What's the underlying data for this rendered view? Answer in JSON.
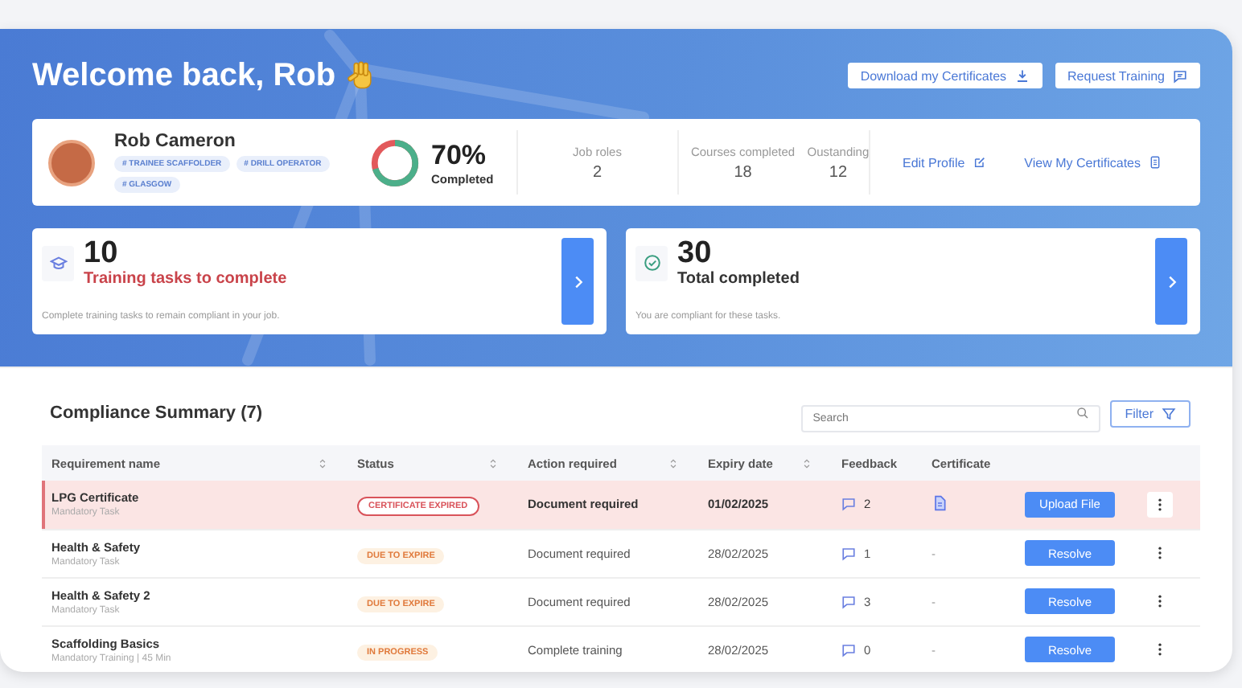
{
  "header": {
    "title": "Welcome back, Rob",
    "buttons": [
      {
        "label": "Download my Certificates"
      },
      {
        "label": "Request Training"
      }
    ]
  },
  "profile": {
    "name": "Rob Cameron",
    "tags": [
      "# TRAINEE SCAFFOLDER",
      "# DRILL OPERATOR",
      "# GLASGOW"
    ],
    "progress": {
      "level": 0.7,
      "value": "70%",
      "label": "Completed"
    },
    "stats": [
      {
        "label": "Job roles",
        "value": "2"
      },
      {
        "label": "Courses completed",
        "value": "18"
      },
      {
        "label": "Oustanding",
        "value": "12"
      }
    ],
    "links": [
      {
        "label": "Edit Profile"
      },
      {
        "label": "View My Certificates"
      }
    ]
  },
  "summary_cards": [
    {
      "kind": "pending",
      "count": "10",
      "title": "Training tasks to complete",
      "description": "Complete training tasks to remain compliant in your job."
    },
    {
      "kind": "completed",
      "count": "30",
      "title": "Total completed",
      "description": "You are compliant for these tasks."
    }
  ],
  "compliance": {
    "title": "Compliance Summary (7)",
    "search": {
      "placeholder": "Search"
    },
    "filter_button": "Filter",
    "columns": [
      {
        "label": "Requirement name",
        "sortable": true
      },
      {
        "label": "Status",
        "sortable": true
      },
      {
        "label": "Action required",
        "sortable": true
      },
      {
        "label": "Expiry date",
        "sortable": true
      },
      {
        "label": "Feedback",
        "sortable": false
      },
      {
        "label": "Certificate",
        "sortable": false
      }
    ],
    "rows": [
      {
        "name": "LPG Certificate",
        "subtitle": "Mandatory Task",
        "highlighted": true,
        "status": {
          "label": "CERTIFICATE EXPIRED",
          "kind": "expired"
        },
        "action": "Document required",
        "expiry": "01/02/2025",
        "feedback": "2",
        "certificate": {
          "kind": "file"
        },
        "button": "Upload File"
      },
      {
        "name": "Health & Safety",
        "subtitle": "Mandatory Task",
        "highlighted": false,
        "status": {
          "label": "DUE TO EXPIRE",
          "kind": "due"
        },
        "action": "Document required",
        "expiry": "28/02/2025",
        "feedback": "1",
        "certificate": {
          "kind": "text",
          "text": "-"
        },
        "button": "Resolve"
      },
      {
        "name": "Health & Safety 2",
        "subtitle": "Mandatory Task",
        "highlighted": false,
        "status": {
          "label": "DUE TO EXPIRE",
          "kind": "due"
        },
        "action": "Document required",
        "expiry": "28/02/2025",
        "feedback": "3",
        "certificate": {
          "kind": "text",
          "text": "-"
        },
        "button": "Resolve"
      },
      {
        "name": "Scaffolding Basics",
        "subtitle": "Mandatory Training | 45 Min",
        "highlighted": false,
        "status": {
          "label": "IN PROGRESS",
          "kind": "progress"
        },
        "action": "Complete training",
        "expiry": "28/02/2025",
        "feedback": "0",
        "certificate": {
          "kind": "text",
          "text": "-"
        },
        "button": "Resolve"
      }
    ]
  }
}
